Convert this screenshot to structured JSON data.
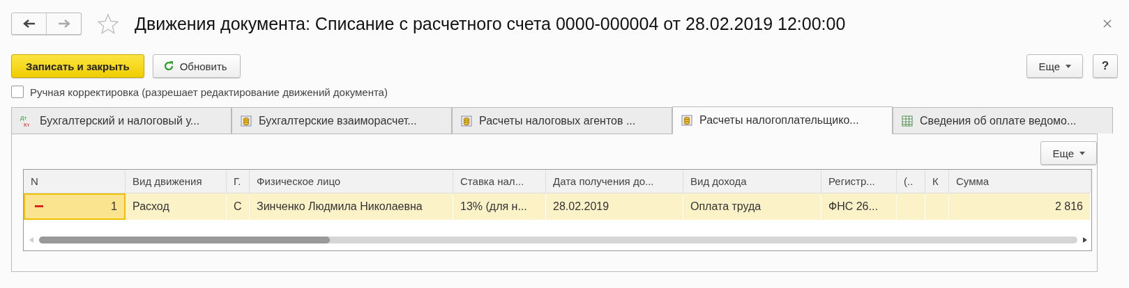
{
  "window": {
    "title": "Движения документа: Списание с расчетного счета 0000-000004 от 28.02.2019 12:00:00",
    "favorite": false
  },
  "toolbar": {
    "primary": "Записать и закрыть",
    "refresh": "Обновить",
    "more": "Еще",
    "help": "?"
  },
  "manual_edit": {
    "label": "Ручная корректировка (разрешает редактирование движений документа)",
    "checked": false
  },
  "tabs": [
    {
      "label": "Бухгалтерский и налоговый у...",
      "kind": "dtkt",
      "icon_top": "Дт",
      "icon_bottom": "Кт",
      "selected": false
    },
    {
      "label": "Бухгалтерские взаиморасчет...",
      "kind": "coins",
      "selected": false
    },
    {
      "label": "Расчеты налоговых агентов ...",
      "kind": "coins",
      "selected": false
    },
    {
      "label": "Расчеты налогоплательщико...",
      "kind": "coins",
      "selected": true
    },
    {
      "label": "Сведения об оплате ведомо...",
      "kind": "grid",
      "selected": false
    }
  ],
  "panel": {
    "more": "Еще"
  },
  "table": {
    "columns": [
      "N",
      "Вид движения",
      "Г.",
      "Физическое лицо",
      "Ставка нал...",
      "Дата получения до...",
      "Вид дохода",
      "Регистр...",
      "(..",
      "К",
      "Сумма"
    ],
    "rows": [
      {
        "kind": "expense",
        "selected": true,
        "cells": [
          "1",
          "Расход",
          "С",
          "Зинченко Людмила Николаевна",
          "13% (для н...",
          "28.02.2019",
          "Оплата труда",
          "ФНС 26...",
          "",
          "",
          "2 816"
        ]
      }
    ]
  }
}
